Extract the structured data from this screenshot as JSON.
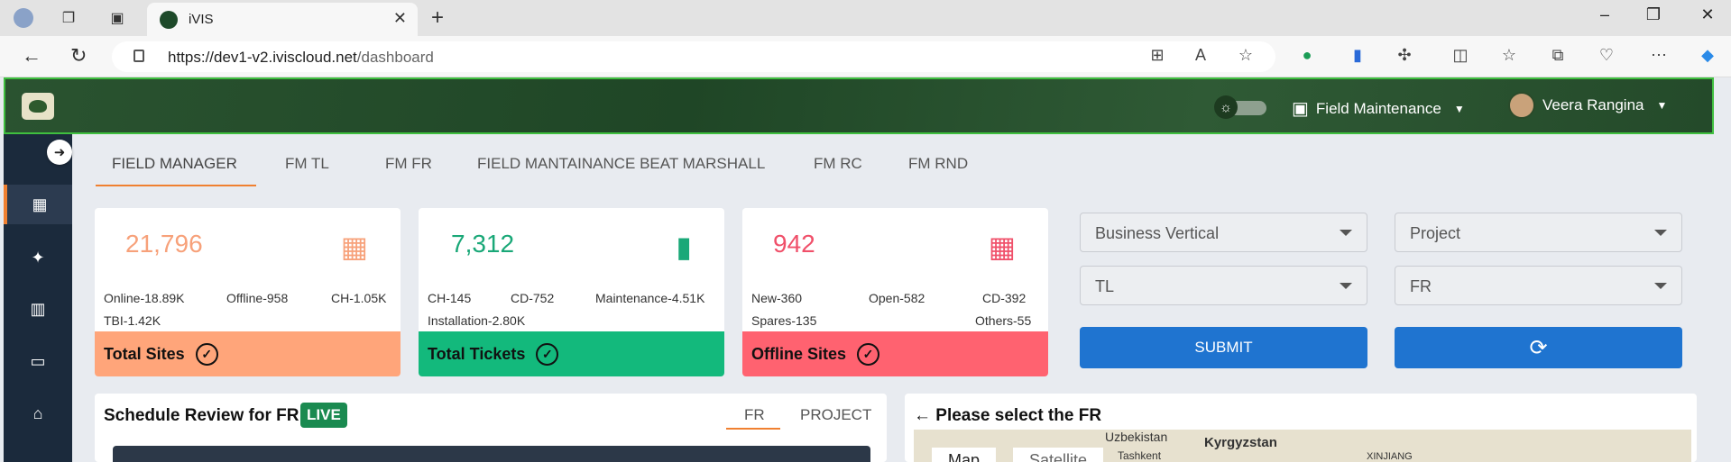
{
  "browser": {
    "tab_title": "iVIS",
    "tab_close": "✕",
    "new_tab": "+",
    "url_host": "https://dev1-v2.iviscloud.net",
    "url_path": "/dashboard"
  },
  "header": {
    "role_label": "Field Maintenance",
    "user_name": "Veera Rangina"
  },
  "tabs": [
    {
      "label": "FIELD MANAGER"
    },
    {
      "label": "FM TL"
    },
    {
      "label": "FM FR"
    },
    {
      "label": "FIELD MANTAINANCE BEAT MARSHALL"
    },
    {
      "label": "FM RC"
    },
    {
      "label": "FM RND"
    }
  ],
  "cards": {
    "sites": {
      "value": "21,796",
      "online": "Online-18.89K",
      "offline": "Offline-958",
      "ch": "CH-1.05K",
      "tbi": "TBI-1.42K",
      "footer": "Total Sites",
      "color": "#ffa57a",
      "value_color": "#f7a17a"
    },
    "tickets": {
      "value": "7,312",
      "ch": "CH-145",
      "cd": "CD-752",
      "maintenance": "Maintenance-4.51K",
      "installation": "Installation-2.80K",
      "footer": "Total Tickets",
      "color": "#13b97c",
      "value_color": "#1aa878"
    },
    "offline": {
      "value": "942",
      "new": "New-360",
      "open": "Open-582",
      "cd": "CD-392",
      "spares": "Spares-135",
      "others": "Others-55",
      "footer": "Offline Sites",
      "color": "#ff6270",
      "value_color": "#f0506a"
    }
  },
  "filters": {
    "business_vertical": "Business Vertical",
    "project": "Project",
    "tl": "TL",
    "fr": "FR",
    "submit_label": "SUBMIT"
  },
  "schedule": {
    "title": "Schedule Review for FR",
    "live": "LIVE",
    "tab_fr": "FR",
    "tab_project": "PROJECT"
  },
  "map_panel": {
    "title": "Please select the FR",
    "labels": [
      "Uzbekistan",
      "Kyrgyzstan",
      "Tashkent",
      "XINJIANG"
    ],
    "map_btn": "Map",
    "satellite_btn": "Satellite"
  }
}
